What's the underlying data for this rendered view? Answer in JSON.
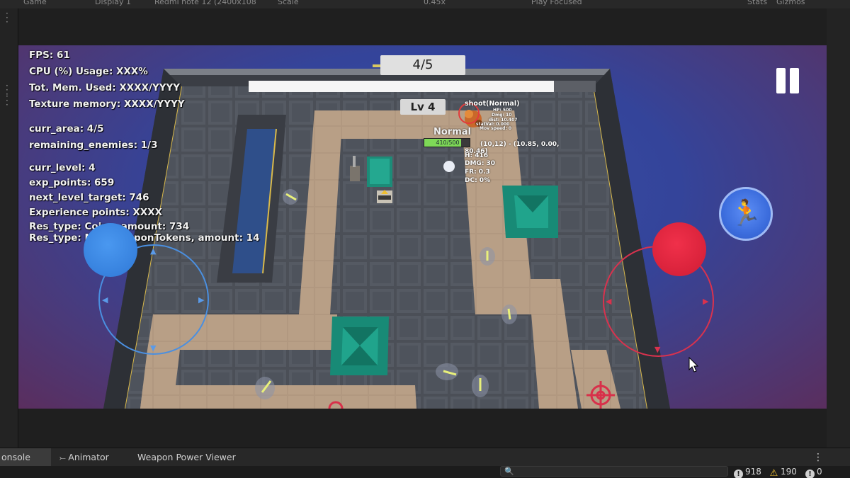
{
  "editor": {
    "top_items": [
      "Game",
      "Display 1",
      "Redmi note 12 (2400x108",
      "Scale",
      "0.45x",
      "Play Focused",
      "Stats",
      "Gizmos"
    ],
    "bottom_tabs": [
      {
        "label": "onsole",
        "active": true
      },
      {
        "label": "Animator",
        "icon": "animator-icon"
      },
      {
        "label": "Weapon Power Viewer"
      }
    ],
    "search_placeholder": "",
    "counts": {
      "errors": "918",
      "warnings": "190",
      "messages": "0"
    }
  },
  "hud": {
    "fps": "FPS: 61",
    "cpu": "CPU (%) Usage: XXX%",
    "mem": "Tot. Mem. Used: XXXX/YYYY",
    "tex": "Texture memory: XXXX/YYYY",
    "curr_area": "curr_area: 4/5",
    "remaining": "remaining_enemies: 1/3",
    "curr_level": "curr_level: 4",
    "exp": "exp_points: 659",
    "next_target": "next_level_target: 746",
    "exp_points": "Experience points: XXXX",
    "res_coins": "Res_type: Coins, amount: 734",
    "res_tokens": "Res_type: MainWeaponTokens, amount: 14"
  },
  "top": {
    "area_counter": "4/5",
    "progress": 0.88,
    "level_badge": "Lv 4"
  },
  "enemy": {
    "state": "shoot(Normal)",
    "difficulty": "Normal",
    "hp_text": "410/500",
    "hp_fraction": 0.82,
    "stats": [
      "HP: 500",
      "Dmg: 10",
      "dist: 10.407",
      "statVal: 0.000",
      "Mov speed: 0"
    ]
  },
  "player": {
    "coords": "(10,12) - (10.85, 0.00,",
    "coords2": "80.46)",
    "stats": [
      "H: 416",
      "DMG: 30",
      "FR: 0.3",
      "DC: 0%"
    ]
  },
  "colors": {
    "left_joystick": "#3f8be8",
    "right_joystick": "#e3243a",
    "floor_tile": "#4b4f57",
    "path_tile": "#b59b84",
    "block": "#1e9c86"
  }
}
